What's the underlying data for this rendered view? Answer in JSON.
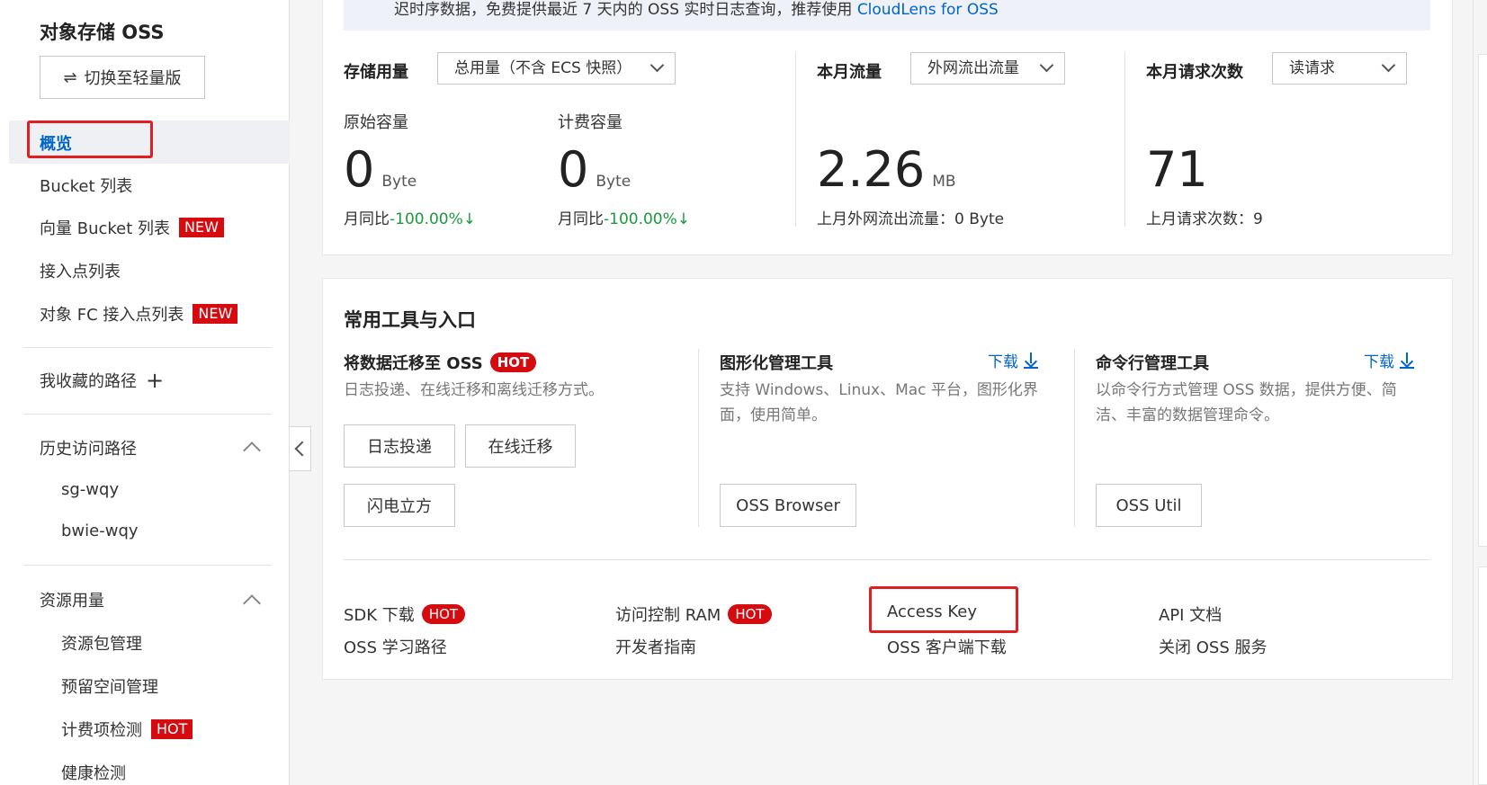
{
  "sidebar": {
    "title": "对象存储 OSS",
    "switch_button": "切换至轻量版",
    "switch_icon": "⇌",
    "items": [
      {
        "label": "概览"
      },
      {
        "label": "Bucket 列表"
      },
      {
        "label": "向量 Bucket 列表",
        "badge": "NEW"
      },
      {
        "label": "接入点列表"
      },
      {
        "label": "对象 FC 接入点列表",
        "badge": "NEW"
      }
    ],
    "favorites": {
      "label": "我收藏的路径",
      "add_icon": "+"
    },
    "history": {
      "label": "历史访问路径",
      "items": [
        "sg-wqy",
        "bwie-wqy"
      ]
    },
    "resources": {
      "label": "资源用量",
      "items": [
        {
          "label": "资源包管理"
        },
        {
          "label": "预留空间管理"
        },
        {
          "label": "计费项检测",
          "badge": "HOT"
        },
        {
          "label": "健康检测"
        }
      ]
    }
  },
  "banner": {
    "text": "迟时序数据，免费提供最近 7 天内的 OSS 实时日志查询，推荐使用",
    "link": "CloudLens for OSS"
  },
  "stats": {
    "storage": {
      "label": "存储用量",
      "select": "总用量（不含 ECS 快照）",
      "raw": {
        "label": "原始容量",
        "value": "0",
        "unit": "Byte",
        "compare_prefix": "月同比",
        "compare_value": "-100.00%",
        "arrow": "↓"
      },
      "billed": {
        "label": "计费容量",
        "value": "0",
        "unit": "Byte",
        "compare_prefix": "月同比",
        "compare_value": "-100.00%",
        "arrow": "↓"
      }
    },
    "traffic": {
      "label": "本月流量",
      "select": "外网流出流量",
      "value": "2.26",
      "unit": "MB",
      "last_month": "上月外网流出流量：0 Byte"
    },
    "requests": {
      "label": "本月请求次数",
      "select": "读请求",
      "value": "71",
      "last_month": "上月请求次数：9"
    }
  },
  "tools": {
    "title": "常用工具与入口",
    "migrate": {
      "title": "将数据迁移至 OSS",
      "badge": "HOT",
      "desc": "日志投递、在线迁移和离线迁移方式。",
      "buttons": [
        "日志投递",
        "在线迁移",
        "闪电立方"
      ]
    },
    "gui": {
      "title": "图形化管理工具",
      "download": "下载",
      "desc": "支持 Windows、Linux、Mac 平台，图形化界面，使用简单。",
      "button": "OSS Browser"
    },
    "cli": {
      "title": "命令行管理工具",
      "download": "下载",
      "desc": "以命令行方式管理 OSS 数据，提供方便、简洁、丰富的数据管理命令。",
      "button": "OSS Util"
    }
  },
  "quick_links": {
    "sdk": {
      "label": "SDK 下载",
      "badge": "HOT"
    },
    "ram": {
      "label": "访问控制 RAM",
      "badge": "HOT"
    },
    "access_key": {
      "label": "Access Key"
    },
    "api": {
      "label": "API 文档"
    },
    "learn": {
      "label": "OSS 学习路径"
    },
    "dev": {
      "label": "开发者指南"
    },
    "client": {
      "label": "OSS 客户端下载"
    },
    "close": {
      "label": "关闭 OSS 服务"
    }
  },
  "colors": {
    "accent": "#0064c8",
    "badge_red": "#d50b10",
    "green": "#1a9a3c",
    "highlight_box": "#e02020"
  }
}
